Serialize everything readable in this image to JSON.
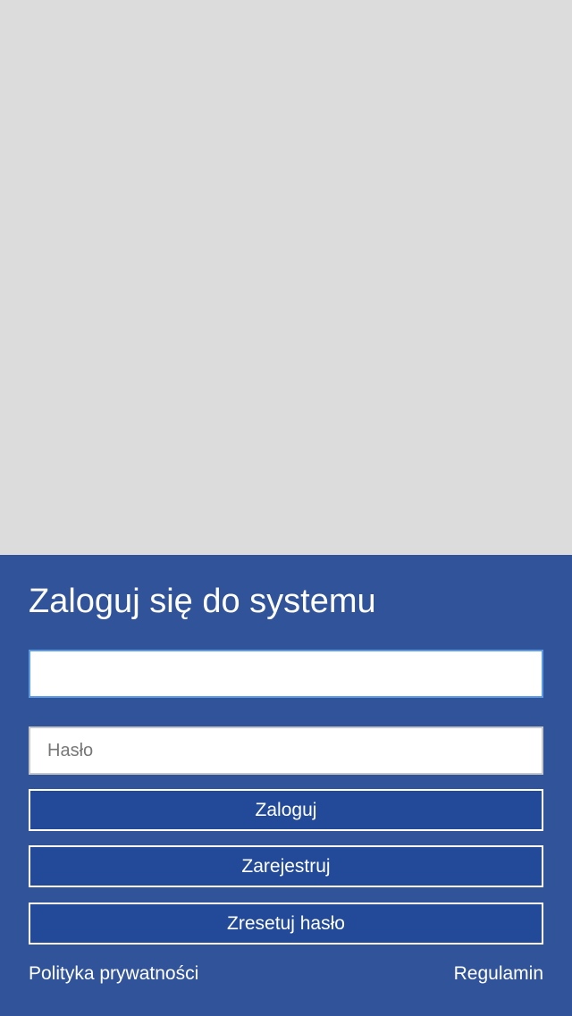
{
  "login": {
    "title": "Zaloguj się do systemu",
    "username_value": "",
    "username_placeholder": "",
    "password_placeholder": "Hasło",
    "login_button": "Zaloguj",
    "register_button": "Zarejestruj",
    "reset_button": "Zresetuj hasło"
  },
  "footer": {
    "privacy_link": "Polityka prywatności",
    "terms_link": "Regulamin"
  },
  "colors": {
    "panel_background": "#31539a",
    "button_background": "#234a98",
    "hero_background": "#dcdcdc",
    "focus_border": "#5b9be6"
  }
}
